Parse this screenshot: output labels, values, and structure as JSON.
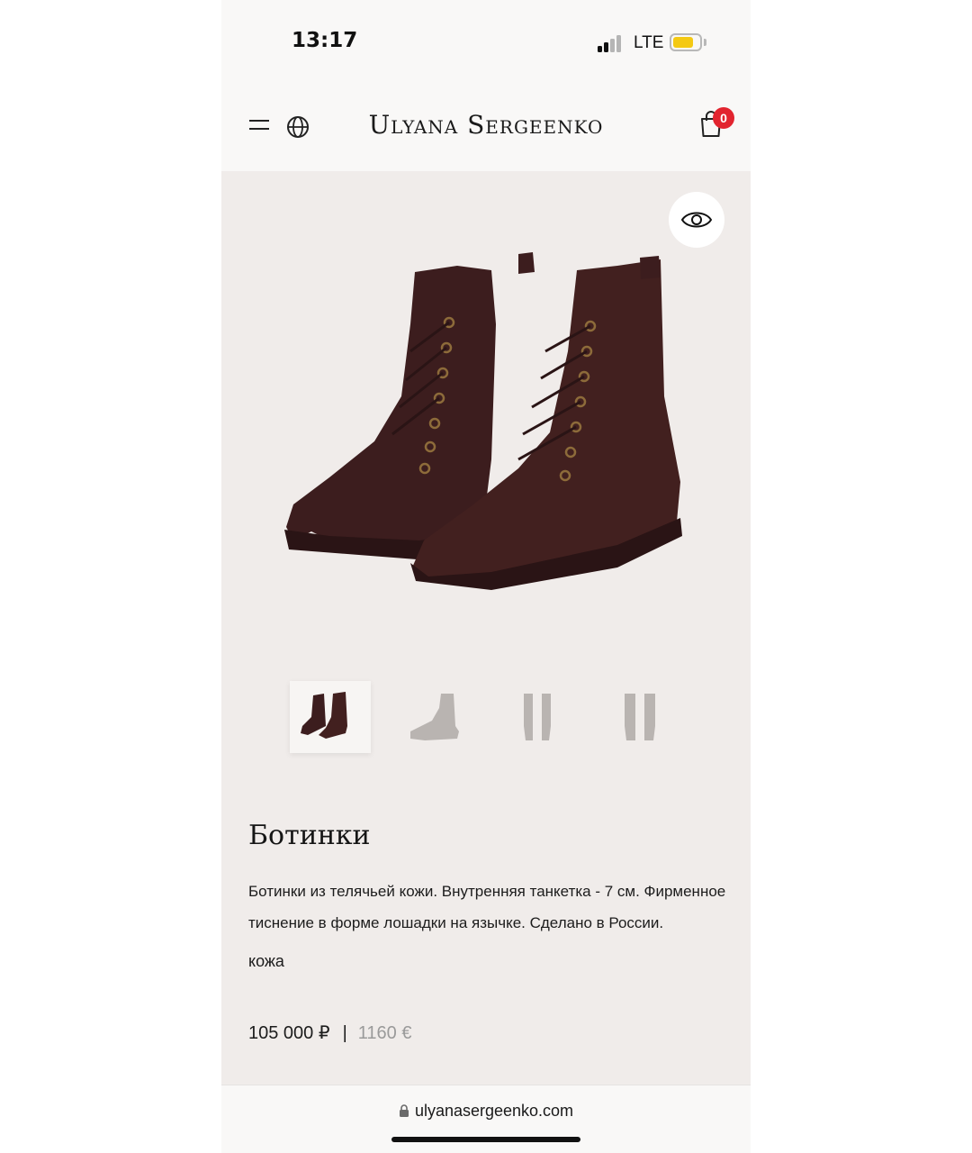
{
  "status_bar": {
    "time": "13:17",
    "network": "LTE",
    "signal_bars_active": 2,
    "battery_level_percent": 70,
    "battery_color": "#f4c913"
  },
  "header": {
    "brand": "Ulyana Sergeenko",
    "cart_count": "0",
    "badge_color": "#e2242f"
  },
  "gallery": {
    "thumbnails": [
      {
        "label": "front-pair",
        "active": true
      },
      {
        "label": "side-view",
        "active": false
      },
      {
        "label": "back-view",
        "active": false
      },
      {
        "label": "back-view-2",
        "active": false
      }
    ]
  },
  "product": {
    "title": "Ботинки",
    "description": "Ботинки из телячьей кожи. Внутренняя танкетка - 7 см. Фирменное тиснение в форме лошадки на язычке. Сделано в России.",
    "material": "кожа",
    "price_rub": "105 000 ₽",
    "separator": "|",
    "price_eur": "1160 €"
  },
  "browser": {
    "url": "ulyanasergeenko.com"
  }
}
